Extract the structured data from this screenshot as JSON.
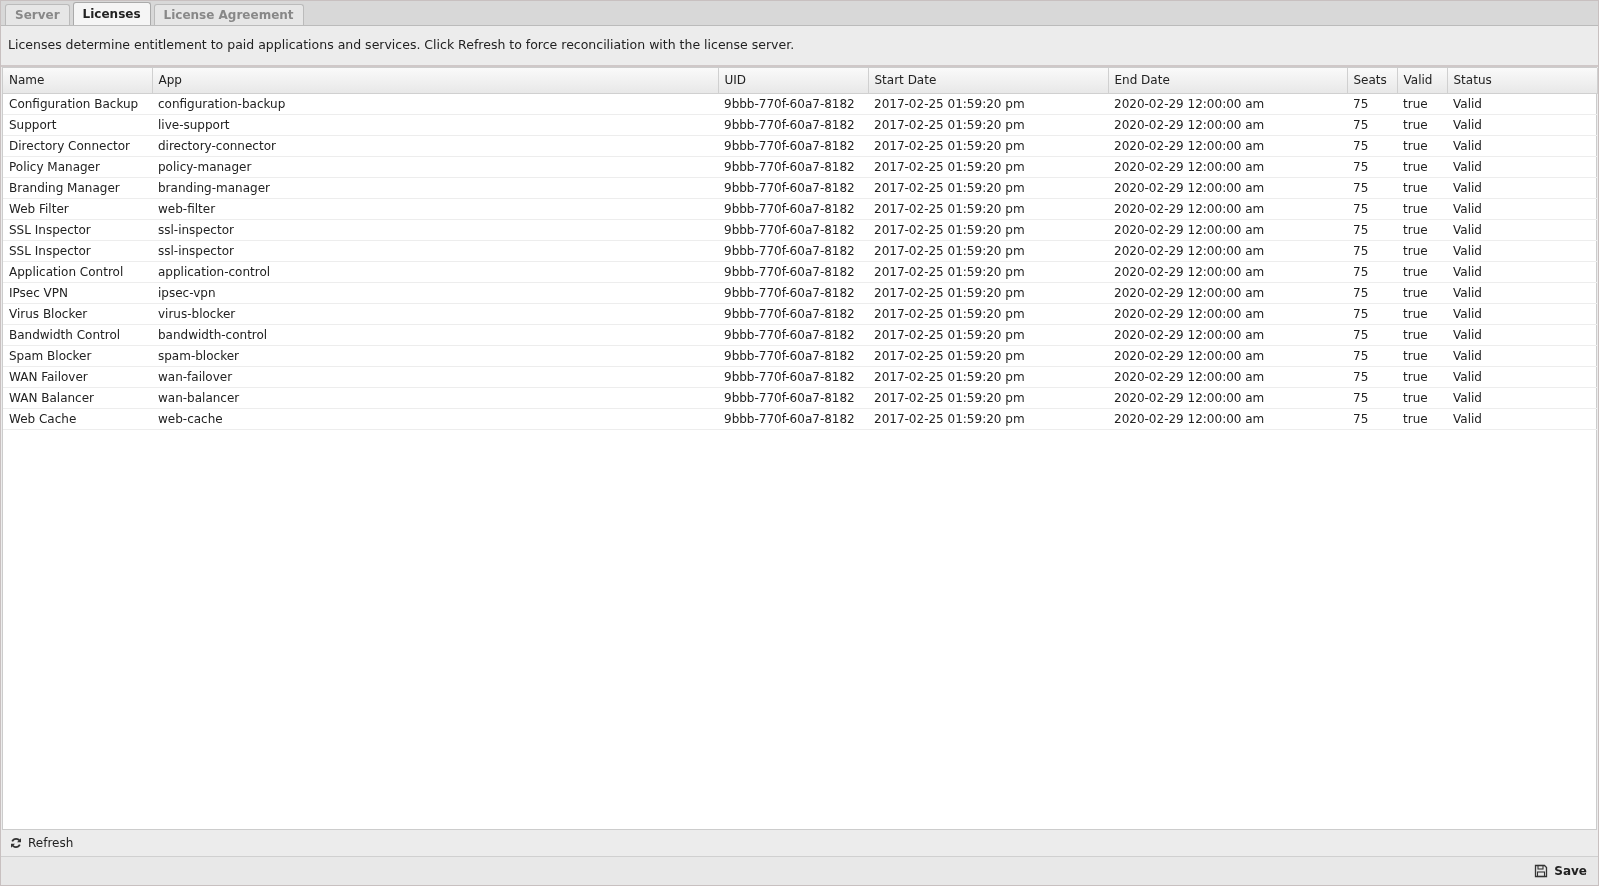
{
  "tabs": [
    {
      "label": "Server",
      "selected": false
    },
    {
      "label": "Licenses",
      "selected": true
    },
    {
      "label": "License Agreement",
      "selected": false
    }
  ],
  "description": "Licenses determine entitlement to paid applications and services. Click Refresh to force reconciliation with the license server.",
  "table": {
    "columns": [
      "Name",
      "App",
      "UID",
      "Start Date",
      "End Date",
      "Seats",
      "Valid",
      "Status"
    ],
    "rows": [
      [
        "Configuration Backup",
        "configuration-backup",
        "9bbb-770f-60a7-8182",
        "2017-02-25 01:59:20 pm",
        "2020-02-29 12:00:00 am",
        "75",
        "true",
        "Valid"
      ],
      [
        "Support",
        "live-support",
        "9bbb-770f-60a7-8182",
        "2017-02-25 01:59:20 pm",
        "2020-02-29 12:00:00 am",
        "75",
        "true",
        "Valid"
      ],
      [
        "Directory Connector",
        "directory-connector",
        "9bbb-770f-60a7-8182",
        "2017-02-25 01:59:20 pm",
        "2020-02-29 12:00:00 am",
        "75",
        "true",
        "Valid"
      ],
      [
        "Policy Manager",
        "policy-manager",
        "9bbb-770f-60a7-8182",
        "2017-02-25 01:59:20 pm",
        "2020-02-29 12:00:00 am",
        "75",
        "true",
        "Valid"
      ],
      [
        "Branding Manager",
        "branding-manager",
        "9bbb-770f-60a7-8182",
        "2017-02-25 01:59:20 pm",
        "2020-02-29 12:00:00 am",
        "75",
        "true",
        "Valid"
      ],
      [
        "Web Filter",
        "web-filter",
        "9bbb-770f-60a7-8182",
        "2017-02-25 01:59:20 pm",
        "2020-02-29 12:00:00 am",
        "75",
        "true",
        "Valid"
      ],
      [
        "SSL Inspector",
        "ssl-inspector",
        "9bbb-770f-60a7-8182",
        "2017-02-25 01:59:20 pm",
        "2020-02-29 12:00:00 am",
        "75",
        "true",
        "Valid"
      ],
      [
        "SSL Inspector",
        "ssl-inspector",
        "9bbb-770f-60a7-8182",
        "2017-02-25 01:59:20 pm",
        "2020-02-29 12:00:00 am",
        "75",
        "true",
        "Valid"
      ],
      [
        "Application Control",
        "application-control",
        "9bbb-770f-60a7-8182",
        "2017-02-25 01:59:20 pm",
        "2020-02-29 12:00:00 am",
        "75",
        "true",
        "Valid"
      ],
      [
        "IPsec VPN",
        "ipsec-vpn",
        "9bbb-770f-60a7-8182",
        "2017-02-25 01:59:20 pm",
        "2020-02-29 12:00:00 am",
        "75",
        "true",
        "Valid"
      ],
      [
        "Virus Blocker",
        "virus-blocker",
        "9bbb-770f-60a7-8182",
        "2017-02-25 01:59:20 pm",
        "2020-02-29 12:00:00 am",
        "75",
        "true",
        "Valid"
      ],
      [
        "Bandwidth Control",
        "bandwidth-control",
        "9bbb-770f-60a7-8182",
        "2017-02-25 01:59:20 pm",
        "2020-02-29 12:00:00 am",
        "75",
        "true",
        "Valid"
      ],
      [
        "Spam Blocker",
        "spam-blocker",
        "9bbb-770f-60a7-8182",
        "2017-02-25 01:59:20 pm",
        "2020-02-29 12:00:00 am",
        "75",
        "true",
        "Valid"
      ],
      [
        "WAN Failover",
        "wan-failover",
        "9bbb-770f-60a7-8182",
        "2017-02-25 01:59:20 pm",
        "2020-02-29 12:00:00 am",
        "75",
        "true",
        "Valid"
      ],
      [
        "WAN Balancer",
        "wan-balancer",
        "9bbb-770f-60a7-8182",
        "2017-02-25 01:59:20 pm",
        "2020-02-29 12:00:00 am",
        "75",
        "true",
        "Valid"
      ],
      [
        "Web Cache",
        "web-cache",
        "9bbb-770f-60a7-8182",
        "2017-02-25 01:59:20 pm",
        "2020-02-29 12:00:00 am",
        "75",
        "true",
        "Valid"
      ]
    ]
  },
  "refresh_button": "Refresh",
  "save_button": "Save"
}
